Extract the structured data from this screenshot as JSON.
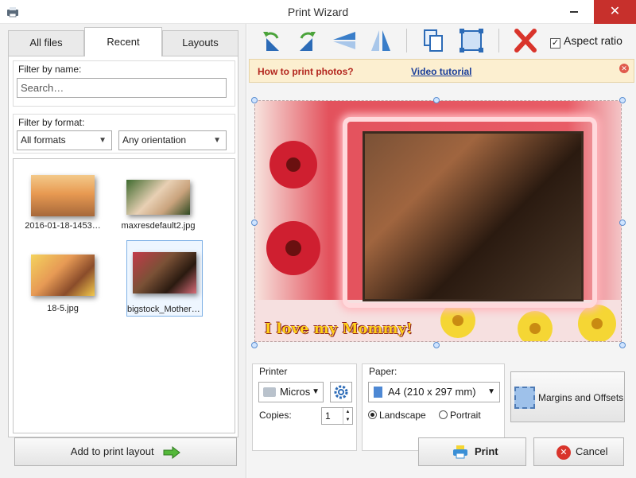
{
  "window": {
    "title": "Print Wizard",
    "close_glyph": "✕"
  },
  "left": {
    "tabs": [
      {
        "label": "All files"
      },
      {
        "label": "Recent"
      },
      {
        "label": "Layouts"
      }
    ],
    "active_tab": "Recent",
    "filter_name": {
      "label": "Filter by name:",
      "placeholder": "Search…"
    },
    "filter_format": {
      "label": "Filter by format:",
      "format": "All formats",
      "orientation": "Any orientation"
    },
    "files": [
      {
        "caption": "2016-01-18-1453…",
        "icon": "photo-thumbnail"
      },
      {
        "caption": "maxresdefault2.jpg",
        "icon": "photo-thumbnail"
      },
      {
        "caption": "18-5.jpg",
        "icon": "photo-thumbnail"
      },
      {
        "caption": "bigstock_Mother_…",
        "icon": "photo-thumbnail",
        "selected": true
      }
    ],
    "add_button": "Add to print layout"
  },
  "toolbar": {
    "buttons": [
      "rotate-left-icon",
      "rotate-right-icon",
      "flip-vertical-icon",
      "flip-horizontal-icon",
      "duplicate-icon",
      "fit-to-frame-icon",
      "delete-icon"
    ],
    "aspect_ratio": {
      "label": "Aspect ratio",
      "checked": true
    }
  },
  "info_bar": {
    "how_to": "How to print photos?",
    "video": "Video tutorial"
  },
  "preview": {
    "caption": "I love my Mommy!",
    "colors": {
      "frame_red": "#d63a47",
      "caption_yellow": "#ffd11a"
    }
  },
  "printer": {
    "label": "Printer",
    "name": "Micros",
    "copies_label": "Copies:",
    "copies": "1"
  },
  "paper": {
    "label": "Paper:",
    "size": "A4 (210 x 297 mm)",
    "orientations": [
      "Landscape",
      "Portrait"
    ],
    "selected": "Landscape"
  },
  "buttons": {
    "margins": "Margins and Offsets",
    "print": "Print",
    "cancel": "Cancel"
  }
}
